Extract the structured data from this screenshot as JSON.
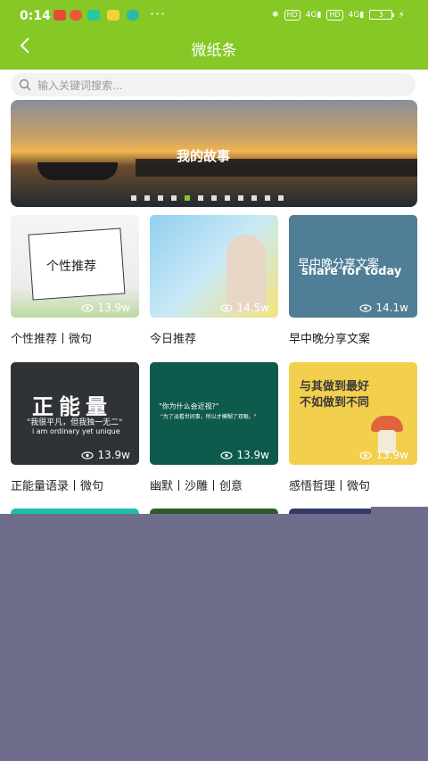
{
  "status_bar": {
    "time": "0:14",
    "more": "···",
    "battery": "3",
    "net1": "4G",
    "net2": "4G",
    "hd1": "HD",
    "hd2": "HD"
  },
  "header": {
    "title": "微纸条"
  },
  "search": {
    "placeholder": "输入关键词搜索..."
  },
  "banner": {
    "title": "我的故事",
    "slide_count": 12,
    "active_slide": 5
  },
  "cards": [
    {
      "label": "个性推荐丨微句",
      "views": "13.9w",
      "image_text": "个性推荐"
    },
    {
      "label": "今日推荐",
      "views": "14.5w",
      "image_text": ""
    },
    {
      "label": "早中晚分享文案",
      "views": "14.1w",
      "image_text": "早中晚分享文案",
      "image_subtext": "share for today"
    },
    {
      "label": "正能量语录丨微句",
      "views": "13.9w",
      "image_text": "正能量",
      "image_subtext": "\"我很平凡，但我独一无二\"",
      "image_subtext2": "i am ordinary yet unique"
    },
    {
      "label": "幽默丨沙雕丨创意",
      "views": "13.9w",
      "image_text": "\"你为什么会近视?\"",
      "image_subtext": "\"为了淡看世间事，所以才模糊了双眼。\""
    },
    {
      "label": "感悟哲理丨微句",
      "views": "13.9w",
      "image_text": "与其做到最好",
      "image_subtext": "不如做到不同"
    }
  ],
  "colors": {
    "accent": "#86c826",
    "overlay": "#6e6e8c"
  }
}
